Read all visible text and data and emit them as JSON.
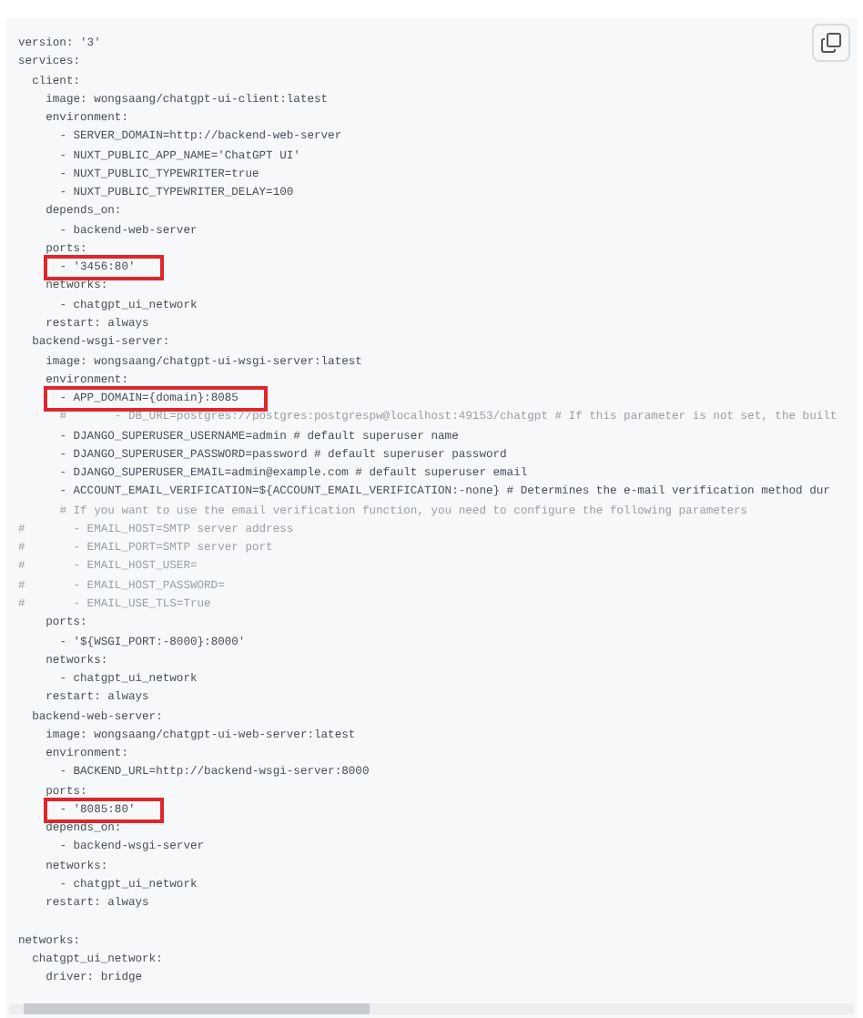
{
  "code_block": {
    "lines": [
      {
        "kind": "code",
        "text": "version: '3'",
        "highlighted": false
      },
      {
        "kind": "code",
        "text": "services:",
        "highlighted": false
      },
      {
        "kind": "code",
        "text": "  client:",
        "highlighted": false
      },
      {
        "kind": "code",
        "text": "    image: wongsaang/chatgpt-ui-client:latest",
        "highlighted": false
      },
      {
        "kind": "code",
        "text": "    environment:",
        "highlighted": false
      },
      {
        "kind": "code",
        "text": "      - SERVER_DOMAIN=http://backend-web-server",
        "highlighted": false
      },
      {
        "kind": "code",
        "text": "      - NUXT_PUBLIC_APP_NAME='ChatGPT UI'",
        "highlighted": false
      },
      {
        "kind": "code",
        "text": "      - NUXT_PUBLIC_TYPEWRITER=true",
        "highlighted": false
      },
      {
        "kind": "code",
        "text": "      - NUXT_PUBLIC_TYPEWRITER_DELAY=100",
        "highlighted": false
      },
      {
        "kind": "code",
        "text": "    depends_on:",
        "highlighted": false
      },
      {
        "kind": "code",
        "text": "      - backend-web-server",
        "highlighted": false
      },
      {
        "kind": "code",
        "text": "    ports:",
        "highlighted": false
      },
      {
        "kind": "code",
        "text": "      - '3456:80'",
        "highlighted": true
      },
      {
        "kind": "code",
        "text": "    networks:",
        "highlighted": false
      },
      {
        "kind": "code",
        "text": "      - chatgpt_ui_network",
        "highlighted": false
      },
      {
        "kind": "code",
        "text": "    restart: always",
        "highlighted": false
      },
      {
        "kind": "code",
        "text": "  backend-wsgi-server:",
        "highlighted": false
      },
      {
        "kind": "code",
        "text": "    image: wongsaang/chatgpt-ui-wsgi-server:latest",
        "highlighted": false
      },
      {
        "kind": "code",
        "text": "    environment:",
        "highlighted": false
      },
      {
        "kind": "code",
        "text": "      - APP_DOMAIN={domain}:8085",
        "highlighted": true
      },
      {
        "kind": "comment",
        "text": "      #       - DB_URL=postgres://postgres:postgrespw@localhost:49153/chatgpt # If this parameter is not set, the built",
        "highlighted": false
      },
      {
        "kind": "code",
        "text": "      - DJANGO_SUPERUSER_USERNAME=admin # default superuser name",
        "highlighted": false
      },
      {
        "kind": "code",
        "text": "      - DJANGO_SUPERUSER_PASSWORD=password # default superuser password",
        "highlighted": false
      },
      {
        "kind": "code",
        "text": "      - DJANGO_SUPERUSER_EMAIL=admin@example.com # default superuser email",
        "highlighted": false
      },
      {
        "kind": "code",
        "text": "      - ACCOUNT_EMAIL_VERIFICATION=${ACCOUNT_EMAIL_VERIFICATION:-none} # Determines the e-mail verification method dur",
        "highlighted": false
      },
      {
        "kind": "comment",
        "text": "      # If you want to use the email verification function, you need to configure the following parameters",
        "highlighted": false
      },
      {
        "kind": "comment",
        "text": "#       - EMAIL_HOST=SMTP server address",
        "highlighted": false
      },
      {
        "kind": "comment",
        "text": "#       - EMAIL_PORT=SMTP server port",
        "highlighted": false
      },
      {
        "kind": "comment",
        "text": "#       - EMAIL_HOST_USER=",
        "highlighted": false
      },
      {
        "kind": "comment",
        "text": "#       - EMAIL_HOST_PASSWORD=",
        "highlighted": false
      },
      {
        "kind": "comment",
        "text": "#       - EMAIL_USE_TLS=True",
        "highlighted": false
      },
      {
        "kind": "code",
        "text": "    ports:",
        "highlighted": false
      },
      {
        "kind": "code",
        "text": "      - '${WSGI_PORT:-8000}:8000'",
        "highlighted": false
      },
      {
        "kind": "code",
        "text": "    networks:",
        "highlighted": false
      },
      {
        "kind": "code",
        "text": "      - chatgpt_ui_network",
        "highlighted": false
      },
      {
        "kind": "code",
        "text": "    restart: always",
        "highlighted": false
      },
      {
        "kind": "code",
        "text": "  backend-web-server:",
        "highlighted": false
      },
      {
        "kind": "code",
        "text": "    image: wongsaang/chatgpt-ui-web-server:latest",
        "highlighted": false
      },
      {
        "kind": "code",
        "text": "    environment:",
        "highlighted": false
      },
      {
        "kind": "code",
        "text": "      - BACKEND_URL=http://backend-wsgi-server:8000",
        "highlighted": false
      },
      {
        "kind": "code",
        "text": "    ports:",
        "highlighted": false
      },
      {
        "kind": "code",
        "text": "      - '8085:80'",
        "highlighted": true
      },
      {
        "kind": "code",
        "text": "    depends_on:",
        "highlighted": false
      },
      {
        "kind": "code",
        "text": "      - backend-wsgi-server",
        "highlighted": false
      },
      {
        "kind": "code",
        "text": "    networks:",
        "highlighted": false
      },
      {
        "kind": "code",
        "text": "      - chatgpt_ui_network",
        "highlighted": false
      },
      {
        "kind": "code",
        "text": "    restart: always",
        "highlighted": false
      },
      {
        "kind": "blank"
      },
      {
        "kind": "code",
        "text": "networks:",
        "highlighted": false
      },
      {
        "kind": "code",
        "text": "  chatgpt_ui_network:",
        "highlighted": false
      },
      {
        "kind": "code",
        "text": "    driver: bridge",
        "highlighted": false
      }
    ]
  }
}
